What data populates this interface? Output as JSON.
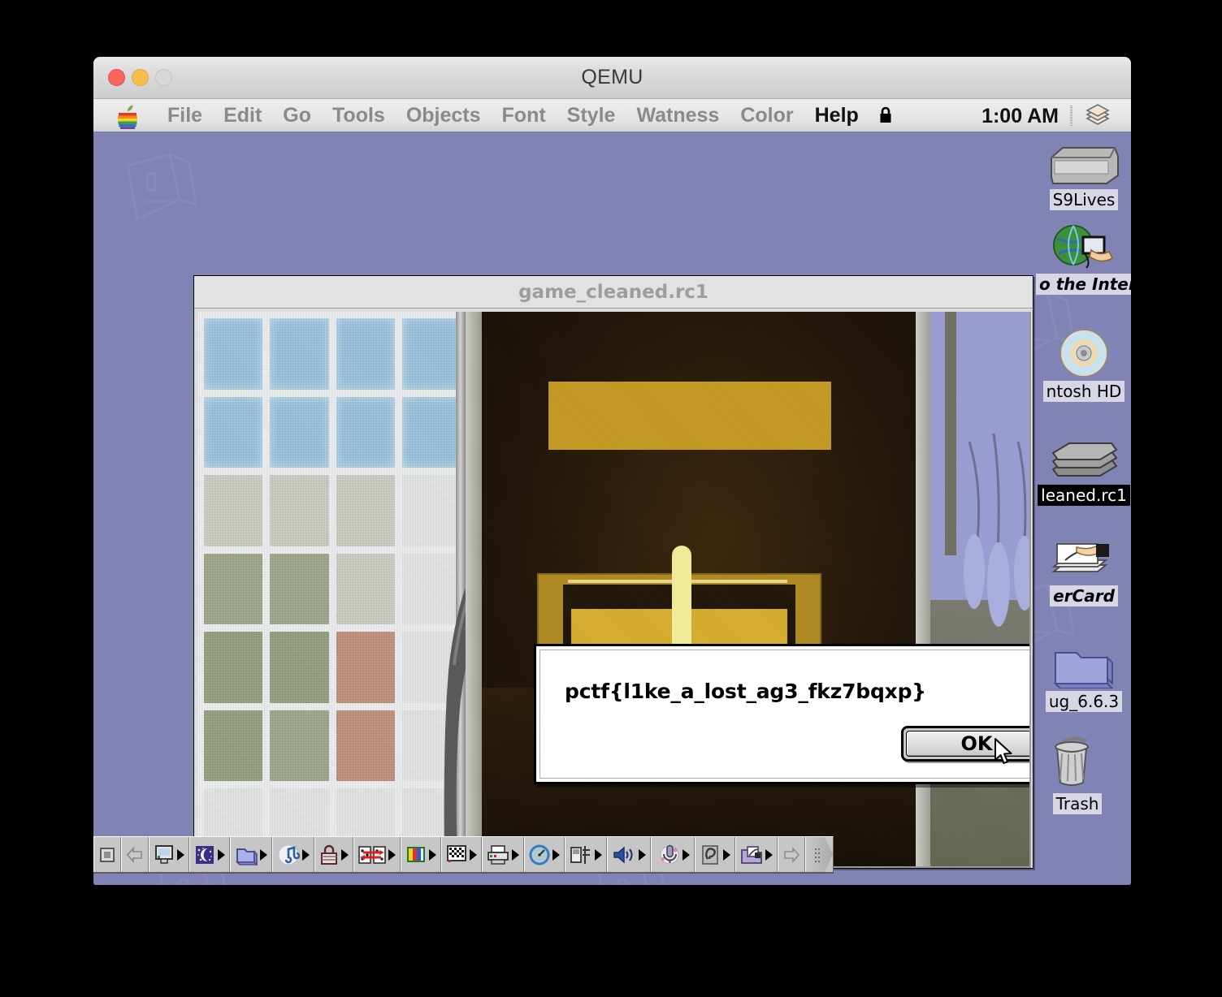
{
  "host": {
    "app_title": "QEMU",
    "traffic_lights": [
      "close",
      "minimize",
      "zoom"
    ]
  },
  "menubar": {
    "apple_icon": "apple-logo-icon",
    "items": [
      {
        "label": "File",
        "enabled": false
      },
      {
        "label": "Edit",
        "enabled": false
      },
      {
        "label": "Go",
        "enabled": false
      },
      {
        "label": "Tools",
        "enabled": false
      },
      {
        "label": "Objects",
        "enabled": false
      },
      {
        "label": "Font",
        "enabled": false
      },
      {
        "label": "Style",
        "enabled": false
      },
      {
        "label": "Watness",
        "enabled": false
      },
      {
        "label": "Color",
        "enabled": false
      },
      {
        "label": "Help",
        "enabled": true
      }
    ],
    "lock_icon": "padlock-icon",
    "clock": "1:00 AM",
    "app_switcher_icon": "application-switcher-icon"
  },
  "desktop": {
    "background_color": "#8183b5",
    "icons": [
      {
        "label": "S9Lives",
        "icon": "hard-disk-icon",
        "selected": false,
        "italic": false
      },
      {
        "label": "o the Internet",
        "icon": "globe-hand-icon",
        "selected": false,
        "italic": true
      },
      {
        "label": "ntosh HD",
        "icon": "cd-disc-icon",
        "selected": false,
        "italic": false
      },
      {
        "label": "leaned.rc1",
        "icon": "stacked-docs-icon",
        "selected": true,
        "italic": false
      },
      {
        "label": "erCard",
        "icon": "hypercard-icon",
        "selected": false,
        "italic": true
      },
      {
        "label": "ug_6.6.3",
        "icon": "folder-icon",
        "selected": false,
        "italic": false
      },
      {
        "label": "Trash",
        "icon": "trash-icon",
        "selected": false,
        "italic": false
      }
    ]
  },
  "window": {
    "title": "game_cleaned.rc1",
    "active": false
  },
  "alert": {
    "message": "pctf{l1ke_a_lost_ag3_fkz7bqxp}",
    "ok_label": "OK"
  },
  "control_strip": {
    "tab_icon": "control-strip-tab-icon",
    "items": [
      {
        "icon": "back-arrow-icon",
        "has_menu": false
      },
      {
        "icon": "monitor-icon",
        "has_menu": true
      },
      {
        "icon": "energy-saver-moon-icon",
        "has_menu": true
      },
      {
        "icon": "file-sharing-folder-icon",
        "has_menu": true
      },
      {
        "icon": "sound-note-icon",
        "has_menu": true
      },
      {
        "icon": "password-lock-icon",
        "has_menu": true
      },
      {
        "icon": "appletalk-switch-icon",
        "has_menu": true
      },
      {
        "icon": "color-depth-icon",
        "has_menu": true
      },
      {
        "icon": "resolution-checker-icon",
        "has_menu": true
      },
      {
        "icon": "printer-icon",
        "has_menu": true
      },
      {
        "icon": "cpu-speed-clock-icon",
        "has_menu": true
      },
      {
        "icon": "file-server-icon",
        "has_menu": true
      },
      {
        "icon": "speaker-volume-icon",
        "has_menu": true
      },
      {
        "icon": "microphone-input-icon",
        "has_menu": true
      },
      {
        "icon": "speakable-items-ear-icon",
        "has_menu": true
      },
      {
        "icon": "remote-access-icon",
        "has_menu": true
      },
      {
        "icon": "forward-arrow-icon",
        "has_menu": false
      }
    ],
    "end_grip_icon": "control-strip-grip-icon"
  },
  "cursor": {
    "icon": "arrow-cursor"
  }
}
